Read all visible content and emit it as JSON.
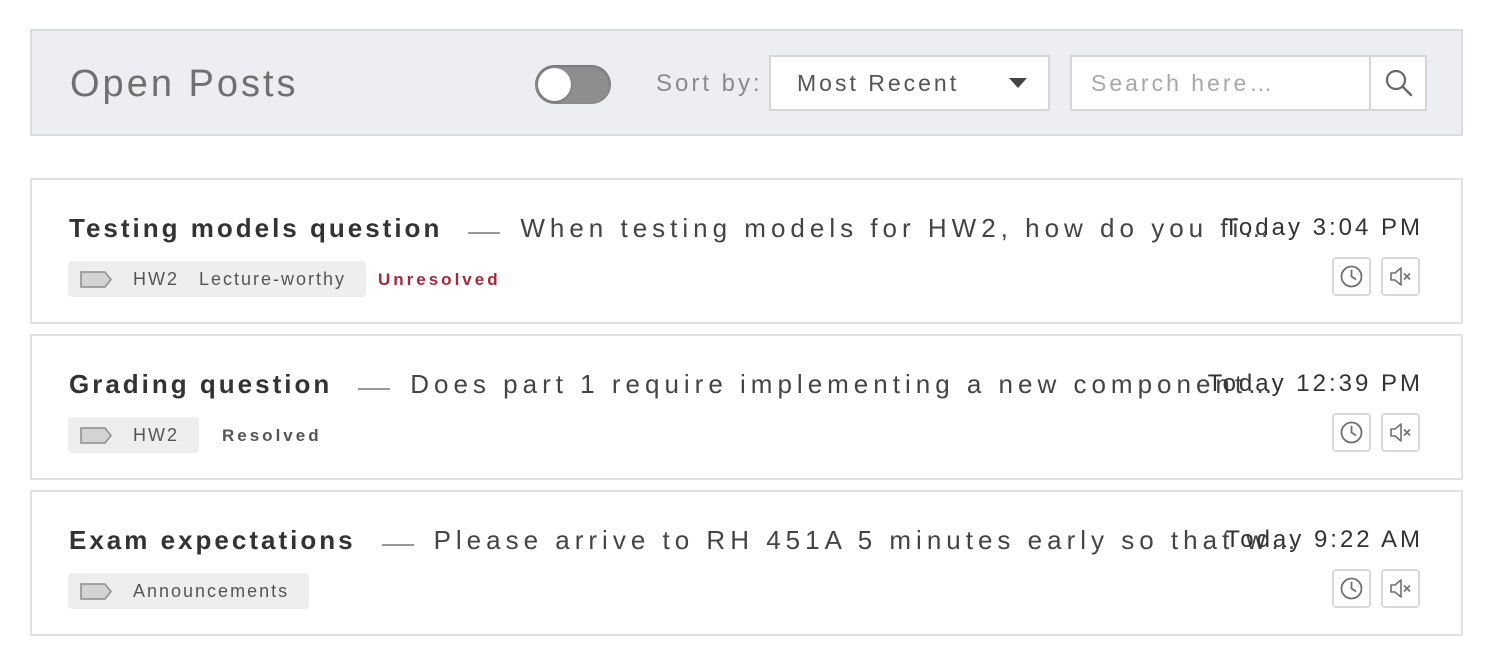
{
  "header": {
    "title": "Open Posts",
    "toggle_on": false,
    "sort_label": "Sort by:",
    "sort_value": "Most Recent",
    "search_placeholder": "Search here…"
  },
  "posts": [
    {
      "title": "Testing models question",
      "snippet": "When testing models for HW2, how do you fi…",
      "time": "Today 3:04 PM",
      "tags": [
        "HW2",
        "Lecture-worthy"
      ],
      "status": "Unresolved",
      "status_color": "#a8283a"
    },
    {
      "title": "Grading question",
      "snippet": "Does part 1 require implementing a new component…",
      "time": "Today 12:39 PM",
      "tags": [
        "HW2"
      ],
      "status": "Resolved",
      "status_color": "#555555"
    },
    {
      "title": "Exam expectations",
      "snippet": "Please arrive to RH 451A 5 minutes early so that w…",
      "time": "Today 9:22 AM",
      "tags": [
        "Announcements"
      ],
      "status": "",
      "status_color": "#555555"
    }
  ],
  "icons": {
    "tag": "tag-icon",
    "snooze": "clock-icon",
    "mute": "mute-icon",
    "search": "search-icon",
    "sort_caret": "caret-down-icon"
  }
}
